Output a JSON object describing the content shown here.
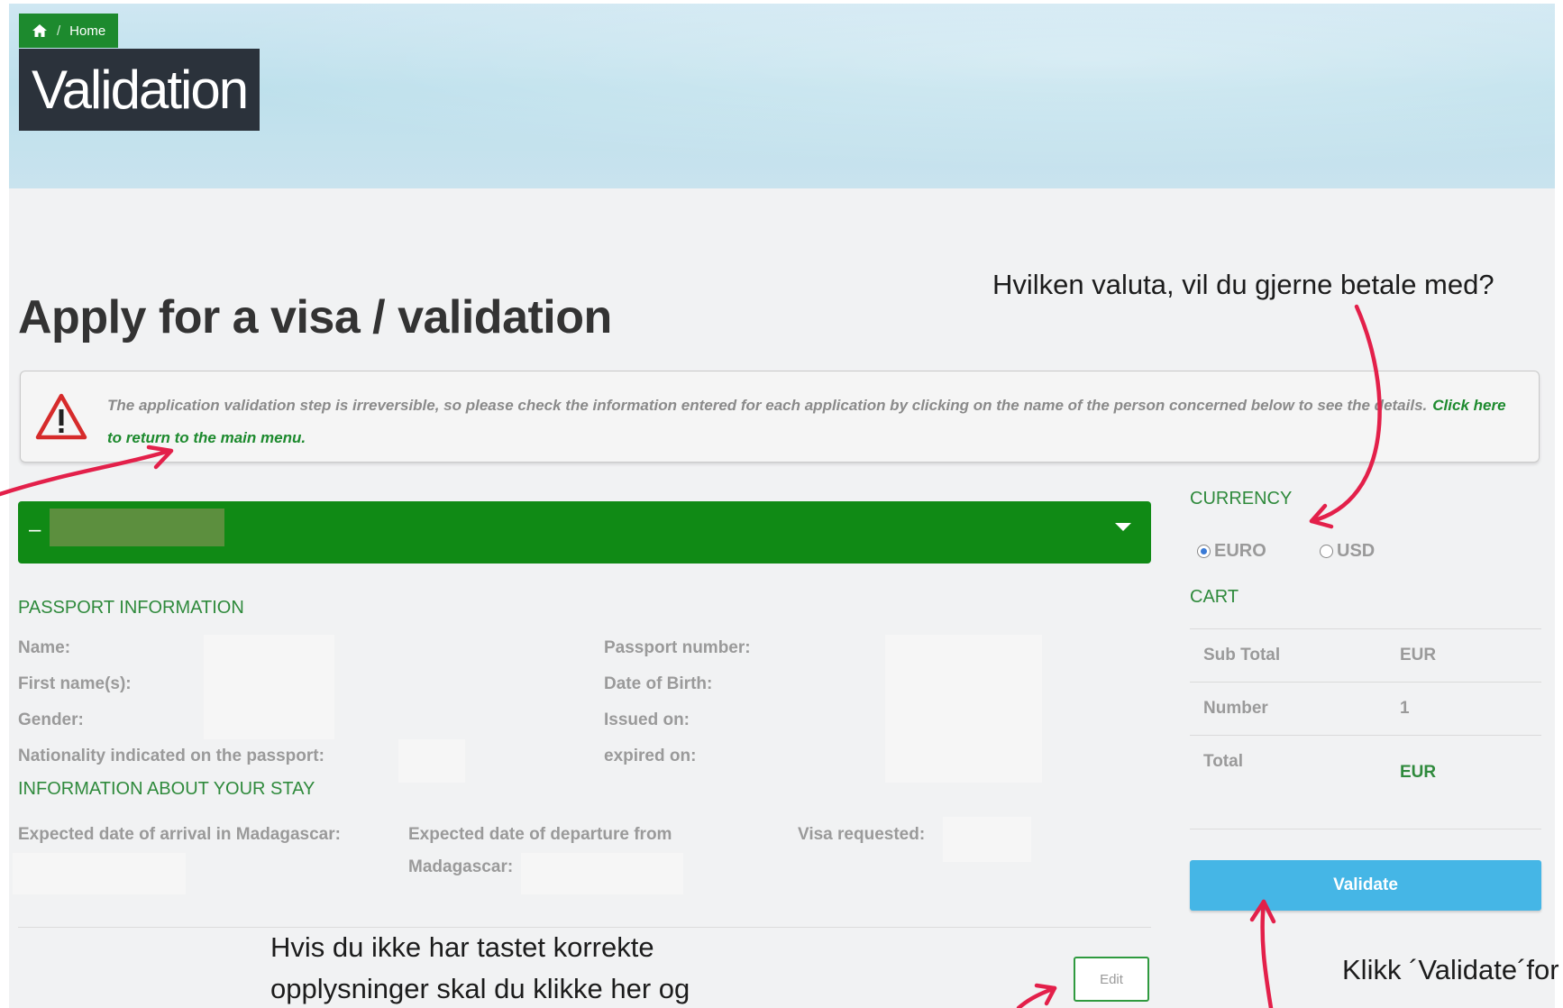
{
  "breadcrumb": {
    "home_label": "Home",
    "separator": "/"
  },
  "banner": {
    "title": "Validation"
  },
  "page": {
    "heading": "Apply for a visa / validation"
  },
  "alert": {
    "message": "The application validation step is irreversible, so please check the information entered for each application by clicking on the name of the person concerned below to see the details.",
    "link_text": "Click here to return to the main menu."
  },
  "applicant": {
    "toggle_symbol": "–"
  },
  "passport": {
    "section_title": "PASSPORT INFORMATION",
    "fields_left": [
      "Name:",
      "First name(s):",
      "Gender:",
      "Nationality indicated on the passport:"
    ],
    "fields_right": [
      "Passport number:",
      "Date of Birth:",
      "Issued on:",
      "expired on:"
    ]
  },
  "stay": {
    "section_title": "INFORMATION ABOUT YOUR STAY",
    "arrival_label": "Expected date of arrival in Madagascar:",
    "departure_label": "Expected date of departure from Madagascar:",
    "visa_label": "Visa requested:"
  },
  "actions": {
    "edit_label": "Edit",
    "validate_label": "Validate"
  },
  "currency": {
    "title": "CURRENCY",
    "options": [
      {
        "label": "EURO",
        "selected": true
      },
      {
        "label": "USD",
        "selected": false
      }
    ]
  },
  "cart": {
    "title": "CART",
    "rows": [
      {
        "label": "Sub Total",
        "value": "EUR"
      },
      {
        "label": "Number",
        "value": "1"
      },
      {
        "label": "Total",
        "value": "EUR"
      }
    ]
  },
  "annotations": {
    "currency_note": "Hvilken valuta, vil du gjerne betale med?",
    "edit_note": "Hvis du ikke har tastet korrekte opplysninger skal du klikke her og",
    "validate_note": "Klikk ´Validate´for å betale"
  },
  "colors": {
    "green": "#108a15",
    "accent_green": "#2f8a3c",
    "validate_blue": "#45b6e6",
    "banner_title_bg": "#2b323b",
    "annotation_arrow": "#e3204a"
  },
  "icons": [
    "home-icon",
    "warning-icon",
    "caret-down-icon"
  ]
}
